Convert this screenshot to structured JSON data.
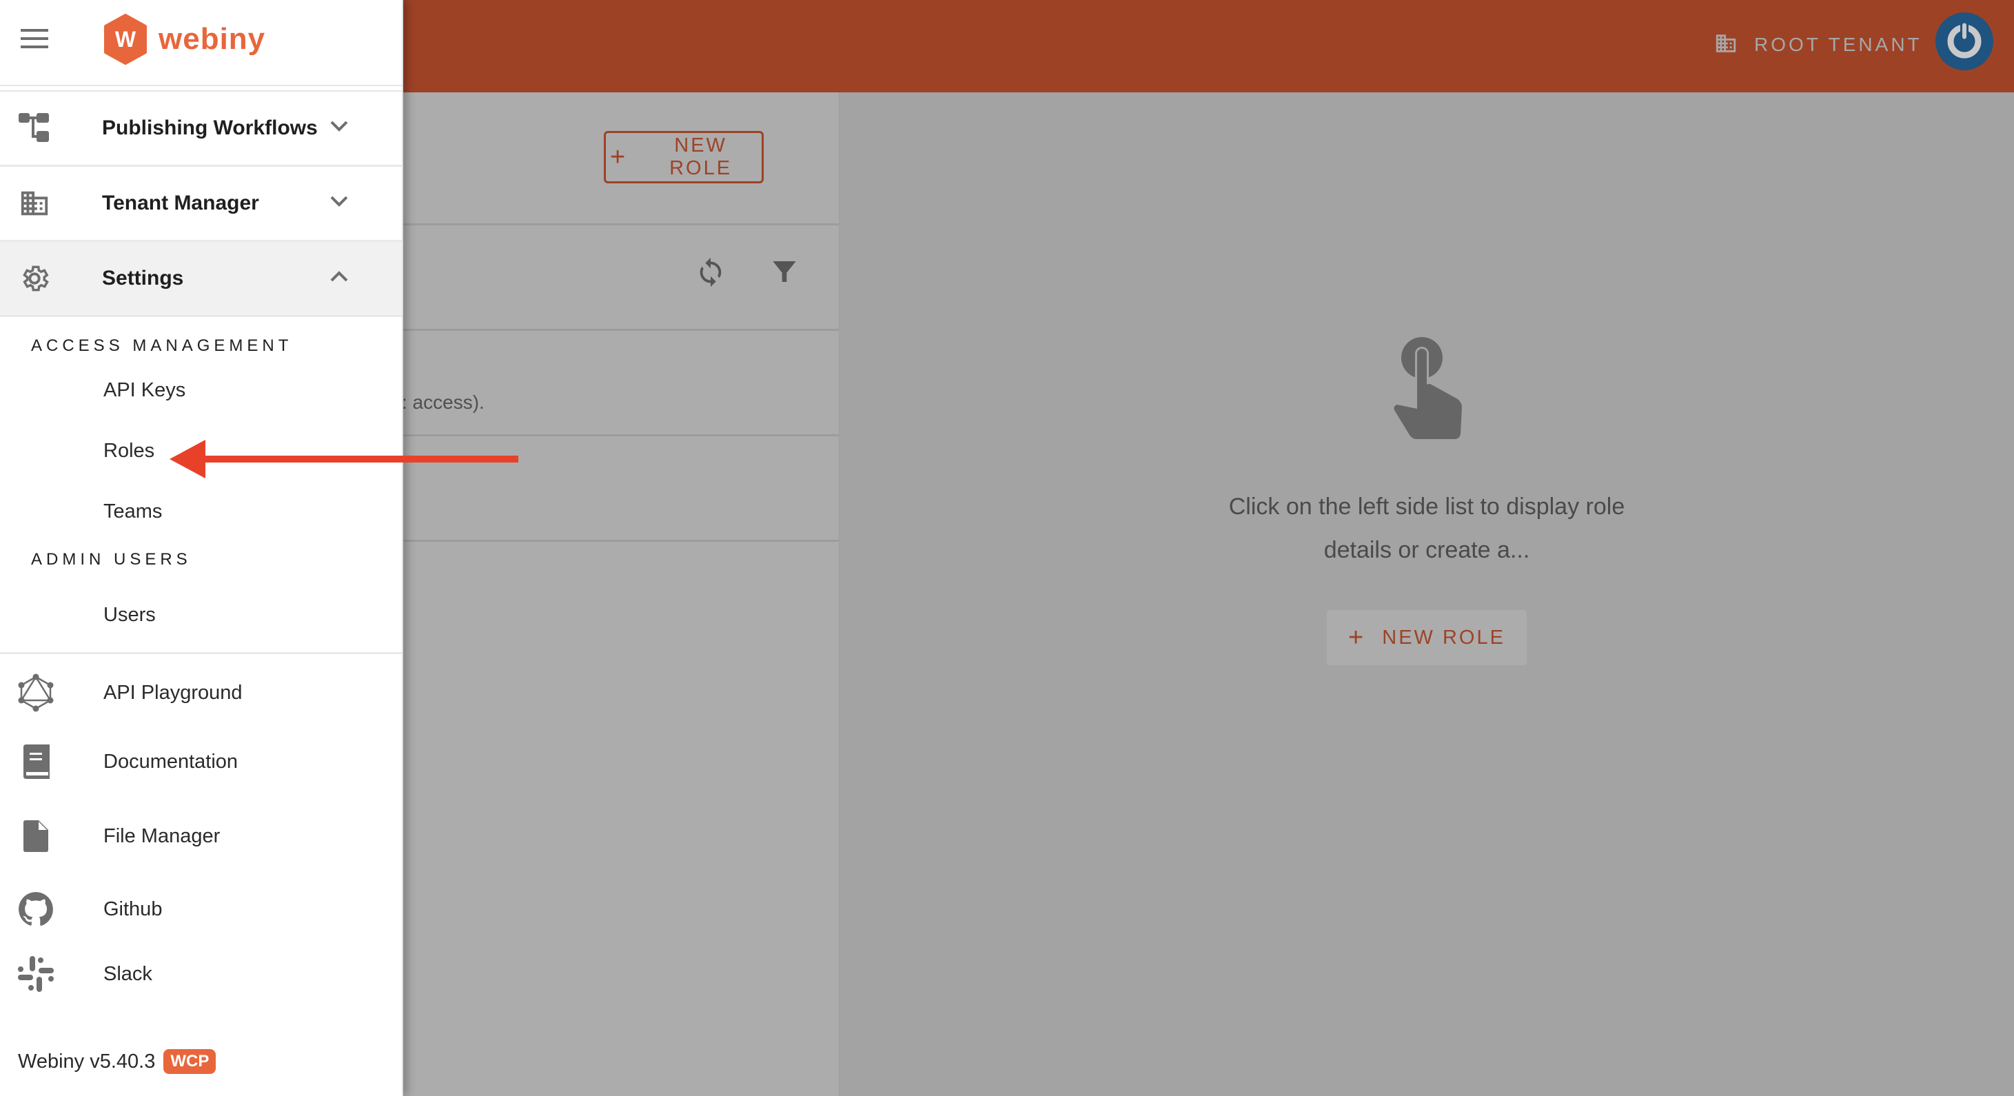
{
  "header": {
    "tenant_label": "ROOT TENANT",
    "tenant_icon": "building-icon",
    "avatar_icon": "power-icon",
    "accent_color": "#9e4226"
  },
  "brand": {
    "logo_letter": "W",
    "logo_text": "webiny",
    "brand_color": "#e8663b"
  },
  "sidebar": {
    "menu": [
      {
        "label": "Publishing Workflows",
        "icon": "workflow-icon",
        "expanded": false
      },
      {
        "label": "Tenant Manager",
        "icon": "building-icon",
        "expanded": false
      },
      {
        "label": "Settings",
        "icon": "gear-icon",
        "expanded": true
      }
    ],
    "sections": [
      {
        "title": "ACCESS MANAGEMENT",
        "items": [
          "API Keys",
          "Roles",
          "Teams"
        ]
      },
      {
        "title": "ADMIN USERS",
        "items": [
          "Users"
        ]
      }
    ],
    "external": [
      {
        "label": "API Playground",
        "icon": "graphql-icon"
      },
      {
        "label": "Documentation",
        "icon": "book-icon"
      },
      {
        "label": "File Manager",
        "icon": "file-icon"
      },
      {
        "label": "Github",
        "icon": "github-icon"
      },
      {
        "label": "Slack",
        "icon": "slack-icon"
      }
    ],
    "footer": {
      "version": "Webiny v5.40.3",
      "badge": "WCP"
    }
  },
  "list": {
    "new_role_label": "NEW ROLE",
    "row_partial_text": ": access)."
  },
  "detail": {
    "empty_message": "Click on the left side list to display role details or create a...",
    "new_role_label": "NEW ROLE"
  },
  "annotation": {
    "arrow_color": "#e8412a",
    "points_to": "Roles"
  }
}
